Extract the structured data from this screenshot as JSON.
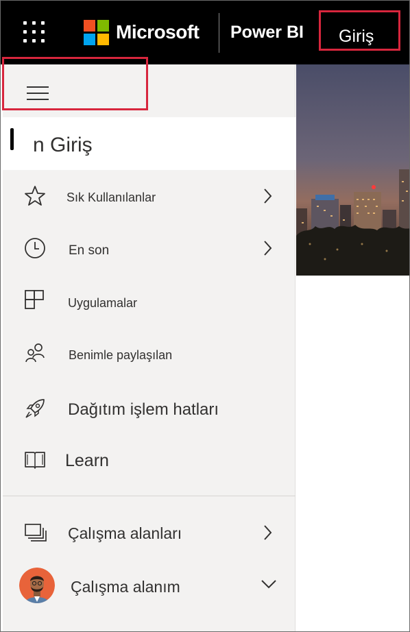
{
  "topbar": {
    "brand": "Microsoft",
    "app_name": "Power BI",
    "home_label": "Giriş",
    "colors": {
      "background": "#000000",
      "highlight_box": "#d7263d"
    }
  },
  "nav": {
    "home": {
      "label": "n Giriş"
    },
    "items": [
      {
        "label": "Sık Kullanılanlar",
        "icon": "star-icon",
        "has_chevron": true
      },
      {
        "label": "En son",
        "icon": "clock-icon",
        "has_chevron": true
      },
      {
        "label": "Uygulamalar",
        "icon": "apps-icon",
        "has_chevron": false
      },
      {
        "label": "Benimle paylaşılan",
        "icon": "shared-people-icon",
        "has_chevron": false
      },
      {
        "label": "Dağıtım işlem hatları",
        "icon": "rocket-icon",
        "has_chevron": false
      },
      {
        "label": "Learn",
        "icon": "book-icon",
        "has_chevron": false
      }
    ],
    "workspaces": {
      "label": "Çalışma alanları",
      "icon": "workspaces-icon"
    },
    "my_workspace": {
      "label": "Çalışma alanım",
      "icon": "avatar"
    }
  }
}
